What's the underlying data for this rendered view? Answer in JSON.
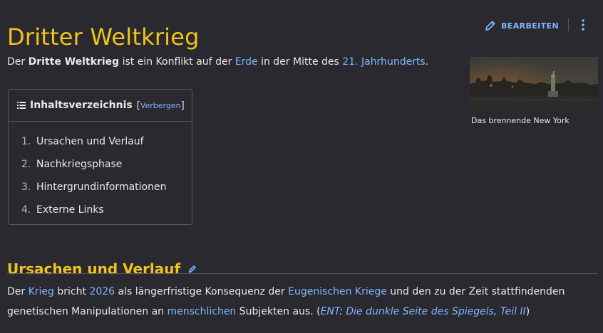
{
  "page": {
    "title": "Dritter Weltkrieg"
  },
  "toolbar": {
    "edit_label": "BEARBEITEN",
    "more_icon": "kebab-icon",
    "edit_icon": "pencil-icon"
  },
  "intro": {
    "t1": "Der ",
    "bold": "Dritte Weltkrieg",
    "t2": " ist ein Konflikt auf der ",
    "link1": "Erde",
    "t3": " in der Mitte des ",
    "link2": "21. Jahrhunderts",
    "t4": "."
  },
  "thumbnail": {
    "caption": "Das brennende New York"
  },
  "toc": {
    "title": "Inhaltsverzeichnis",
    "toggle": "Verbergen",
    "items": [
      {
        "num": "1.",
        "label": "Ursachen und Verlauf"
      },
      {
        "num": "2.",
        "label": "Nachkriegsphase"
      },
      {
        "num": "3.",
        "label": "Hintergrundinformationen"
      },
      {
        "num": "4.",
        "label": "Externe Links"
      }
    ]
  },
  "section": {
    "heading": "Ursachen und Verlauf",
    "p": {
      "t1": "Der ",
      "l1": "Krieg",
      "t2": " bricht ",
      "l2": "2026",
      "t3": " als längerfristige Konsequenz der ",
      "l3": "Eugenischen Kriege",
      "t4": " und den zu der Zeit stattfindenden genetischen Manipulationen an ",
      "l4": "menschlichen",
      "t5": " Subjekten aus. (",
      "l5": "ENT",
      "t6": ": ",
      "l6": "Die dunkle Seite des Spiegels, Teil II",
      "t7": ")"
    }
  },
  "colors": {
    "background": "#2a292f",
    "heading": "#f0c419",
    "link": "#7fb6ff",
    "text": "#e8e8ea"
  }
}
